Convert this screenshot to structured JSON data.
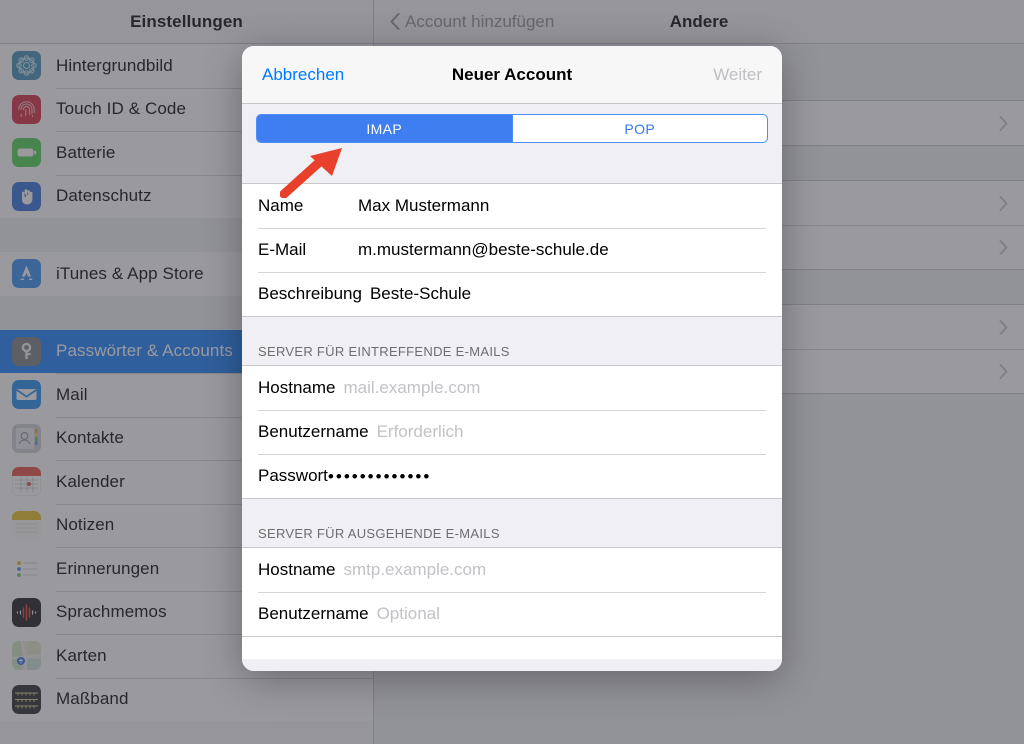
{
  "sidebar": {
    "header_title": "Einstellungen",
    "groups": [
      {
        "items": [
          {
            "label": "Hintergrundbild",
            "icon": "wallpaper-icon",
            "color": "#3d8fb5",
            "selected": false
          },
          {
            "label": "Touch ID & Code",
            "icon": "fingerprint-icon",
            "color": "#d5283c",
            "selected": false
          },
          {
            "label": "Batterie",
            "icon": "battery-icon",
            "color": "#4cd04c",
            "selected": false
          },
          {
            "label": "Datenschutz",
            "icon": "hand-icon",
            "color": "#2f6fdc",
            "selected": false
          }
        ]
      },
      {
        "items": [
          {
            "label": "iTunes & App Store",
            "icon": "app-store-icon",
            "color": "#2f8ef0",
            "selected": false
          }
        ]
      },
      {
        "items": [
          {
            "label": "Passwörter & Accounts",
            "icon": "key-icon",
            "color": "#8e8e93",
            "selected": true
          },
          {
            "label": "Mail",
            "icon": "mail-icon",
            "color": "#1f8df0",
            "selected": false
          },
          {
            "label": "Kontakte",
            "icon": "contacts-icon",
            "color": "#b9b9be",
            "selected": false
          },
          {
            "label": "Kalender",
            "icon": "calendar-icon",
            "color": "#ffffff",
            "selected": false
          },
          {
            "label": "Notizen",
            "icon": "notes-icon",
            "color": "#ffffff",
            "selected": false
          },
          {
            "label": "Erinnerungen",
            "icon": "reminders-icon",
            "color": "#ffffff",
            "selected": false
          },
          {
            "label": "Sprachmemos",
            "icon": "voice-memos-icon",
            "color": "#1c1c1e",
            "selected": false
          },
          {
            "label": "Karten",
            "icon": "maps-icon",
            "color": "#e8e8e8",
            "selected": false
          },
          {
            "label": "Maßband",
            "icon": "measure-icon",
            "color": "#262626",
            "selected": false
          }
        ]
      }
    ]
  },
  "detail": {
    "back_label": "Account hinzufügen",
    "title": "Andere",
    "groups": [
      {
        "rows": [
          {
            "label": ""
          }
        ]
      },
      {
        "rows": [
          {
            "label": ""
          },
          {
            "label": ""
          }
        ]
      },
      {
        "rows": [
          {
            "label": ""
          },
          {
            "label": ""
          }
        ]
      }
    ]
  },
  "modal": {
    "cancel_label": "Abbrechen",
    "title": "Neuer Account",
    "next_label": "Weiter",
    "segmented": {
      "options": [
        {
          "label": "IMAP",
          "active": true
        },
        {
          "label": "POP",
          "active": false
        }
      ]
    },
    "account_section": {
      "rows": [
        {
          "label": "Name",
          "value": "Max Mustermann",
          "placeholder": false
        },
        {
          "label": "E-Mail",
          "value": "m.mustermann@beste-schule.de",
          "placeholder": false
        },
        {
          "label": "Beschreibung",
          "value": "Beste-Schule",
          "placeholder": false
        }
      ]
    },
    "incoming_section": {
      "header": "SERVER FÜR EINTREFFENDE E-MAILS",
      "rows": [
        {
          "label": "Hostname",
          "value": "mail.example.com",
          "placeholder": true
        },
        {
          "label": "Benutzername",
          "value": "Erforderlich",
          "placeholder": true
        },
        {
          "label": "Passwort",
          "value": "•••••••••••••",
          "placeholder": false
        }
      ]
    },
    "outgoing_section": {
      "header": "SERVER FÜR AUSGEHENDE E-MAILS",
      "rows": [
        {
          "label": "Hostname",
          "value": "smtp.example.com",
          "placeholder": true
        },
        {
          "label": "Benutzername",
          "value": "Optional",
          "placeholder": true
        }
      ]
    }
  },
  "annotation": {
    "arrow_color": "#e8402a",
    "points_to": "IMAP"
  },
  "colors": {
    "accent_blue": "#007aff",
    "segment_blue": "#3f7ef0",
    "selected_row_blue": "#147efb",
    "arrow_red": "#e8402a"
  }
}
